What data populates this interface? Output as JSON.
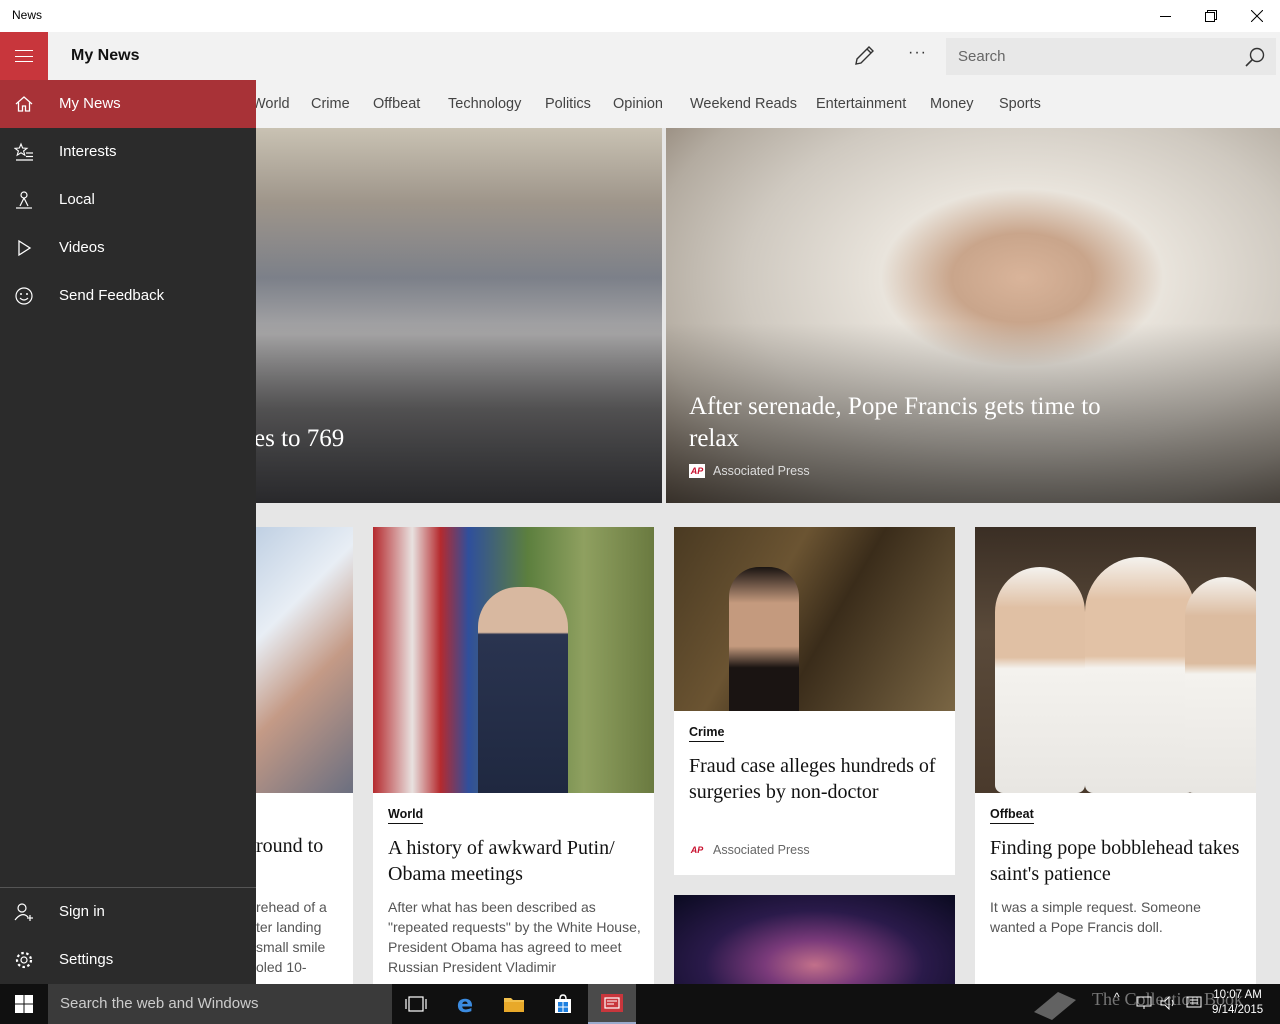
{
  "window": {
    "title": "News"
  },
  "appbar": {
    "page_title": "My News",
    "more": "···",
    "search_placeholder": "Search"
  },
  "tabs": [
    "World",
    "Crime",
    "Offbeat",
    "Technology",
    "Politics",
    "Opinion",
    "Weekend Reads",
    "Entertainment",
    "Money",
    "Sports"
  ],
  "drawer": {
    "items": [
      "My News",
      "Interests",
      "Local",
      "Videos",
      "Send Feedback"
    ],
    "bottom_items": [
      "Sign in",
      "Settings"
    ]
  },
  "hero": {
    "left_title": "es to 769",
    "right_title": "After serenade, Pope Francis gets time to relax",
    "right_source": "Associated Press"
  },
  "cards": {
    "partial": {
      "title": "round to",
      "body": "rehead of a ter landing small smile oled 10-"
    },
    "putin": {
      "category": "World",
      "title": "A history of awkward Putin/ Obama meetings",
      "body": "After what has been described as \"repeated requests\" by the White House, President Obama has agreed to meet Russian President Vladimir"
    },
    "fraud": {
      "category": "Crime",
      "title": "Fraud case alleges hundreds of surgeries by non-doctor",
      "source": "Associated Press"
    },
    "pope": {
      "category": "Offbeat",
      "title": "Finding pope bobblehead takes saint's patience",
      "body": "It was a simple request. Someone wanted a Pope Francis doll."
    }
  },
  "taskbar": {
    "search_text": "Search the web and Windows",
    "watermark": "The Collection Book",
    "time": "10:07 AM",
    "date": "9/14/2015"
  },
  "colors": {
    "accent": "#c8363c",
    "drawer_bg": "#2b2b2b",
    "active_nav": "#a83237",
    "ap_red": "#c8102e"
  }
}
